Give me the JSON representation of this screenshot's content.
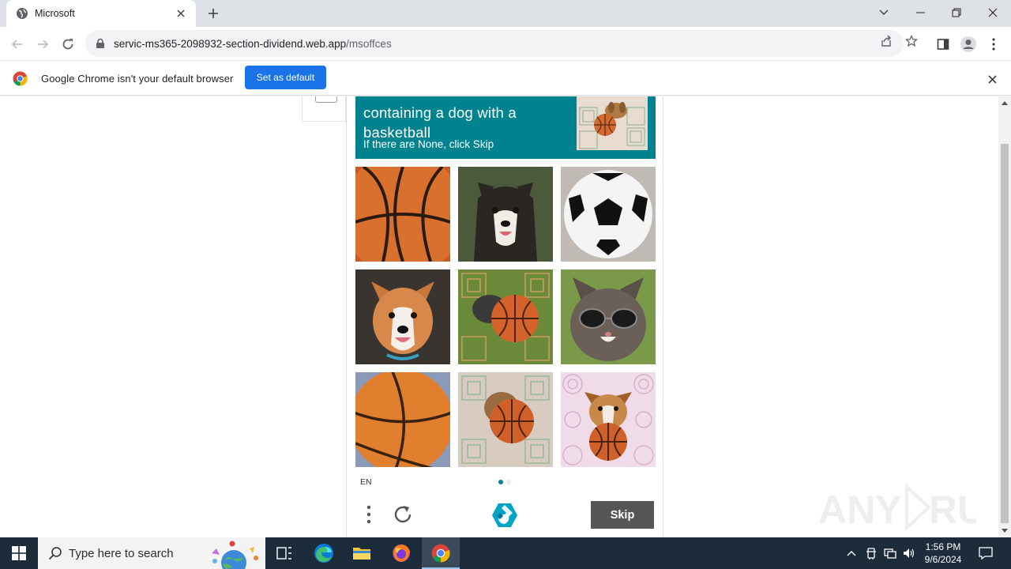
{
  "browser": {
    "tab_title": "Microsoft",
    "url_host": "servic-ms365-2098932-section-dividend.web.app",
    "url_path": "/msoffces"
  },
  "infobar": {
    "message": "Google Chrome isn't your default browser",
    "button_label": "Set as default"
  },
  "captcha": {
    "prompt_partial_first_line": "containing a dog with a",
    "prompt_second_line": "basketball",
    "subprompt": "If there are None, click Skip",
    "grid_images": [
      "basketball",
      "dog",
      "soccer-ball",
      "dog",
      "dog-with-basketball",
      "cat-with-sunglasses",
      "basketball",
      "dog-with-basketball",
      "dog-with-basketball"
    ],
    "language": "EN",
    "page_indicator": {
      "current": 1,
      "total": 2
    },
    "skip_label": "Skip"
  },
  "watermark": "ANY RUN",
  "taskbar": {
    "search_placeholder": "Type here to search",
    "time": "1:56 PM",
    "date": "9/6/2024"
  },
  "colors": {
    "prompt_bg": "#00838f",
    "skip_bg": "#555555",
    "chrome_blue": "#1a73e8",
    "taskbar_bg": "#1c2c3a"
  }
}
